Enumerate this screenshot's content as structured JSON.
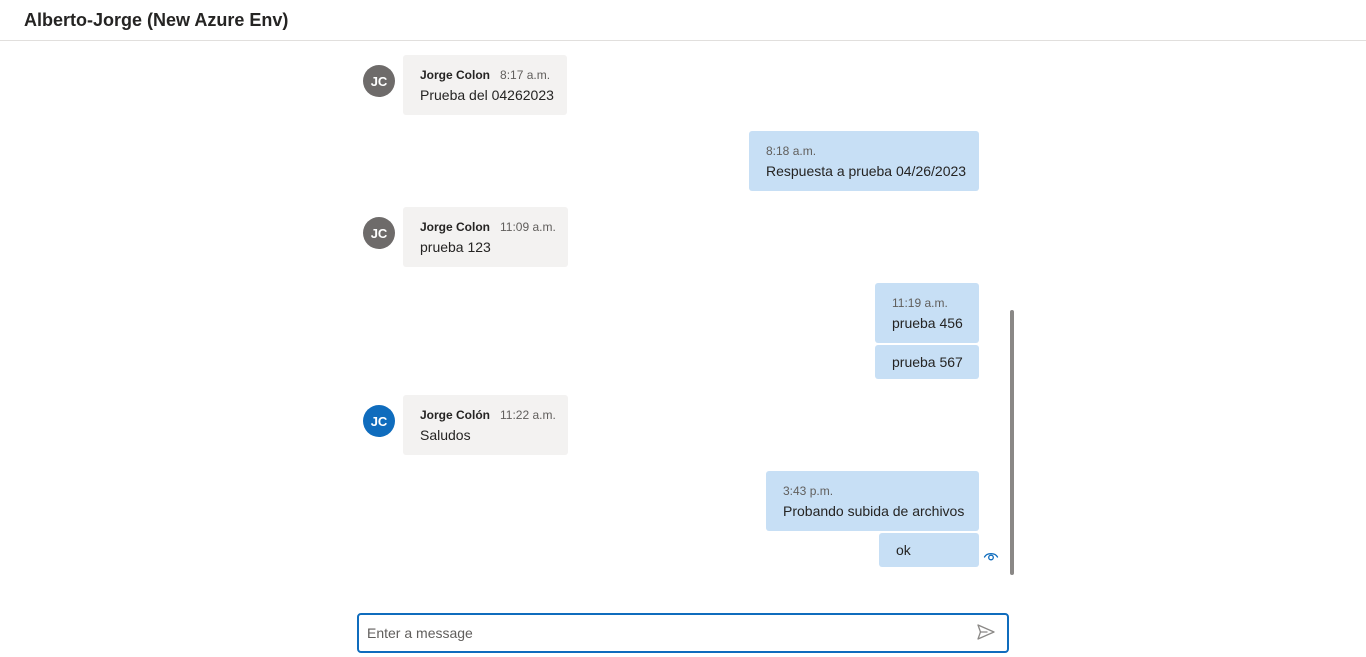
{
  "header": {
    "title": "Alberto-Jorge (New Azure Env)"
  },
  "messages": [
    {
      "direction": "in",
      "avatar": "JC",
      "avatar_color": "#6e6b6a",
      "sender": "Jorge Colon",
      "time": "8:17 a.m.",
      "text": "Prueba del 04262023"
    },
    {
      "direction": "out",
      "time": "8:18 a.m.",
      "text": "Respuesta a prueba 04/26/2023"
    },
    {
      "direction": "in",
      "avatar": "JC",
      "avatar_color": "#6e6b6a",
      "sender": "Jorge Colon",
      "time": "11:09 a.m.",
      "text": "prueba 123"
    },
    {
      "direction": "out",
      "time": "11:19 a.m.",
      "text": "prueba 456"
    },
    {
      "direction": "out",
      "text": "prueba 567"
    },
    {
      "direction": "in",
      "avatar": "JC",
      "avatar_color": "#0f6cbd",
      "sender": "Jorge Colón",
      "time": "11:22 a.m.",
      "text": "Saludos"
    },
    {
      "direction": "out",
      "time": "3:43 p.m.",
      "text": "Probando subida de archivos"
    },
    {
      "direction": "out",
      "text": "ok",
      "status_icon": "seen-eye-icon"
    }
  ],
  "composer": {
    "placeholder": "Enter a message",
    "send_icon": "send-icon"
  },
  "colors": {
    "accent": "#0f6cbd",
    "incoming_bubble": "#f3f2f1",
    "outgoing_bubble": "#c7dff5"
  }
}
